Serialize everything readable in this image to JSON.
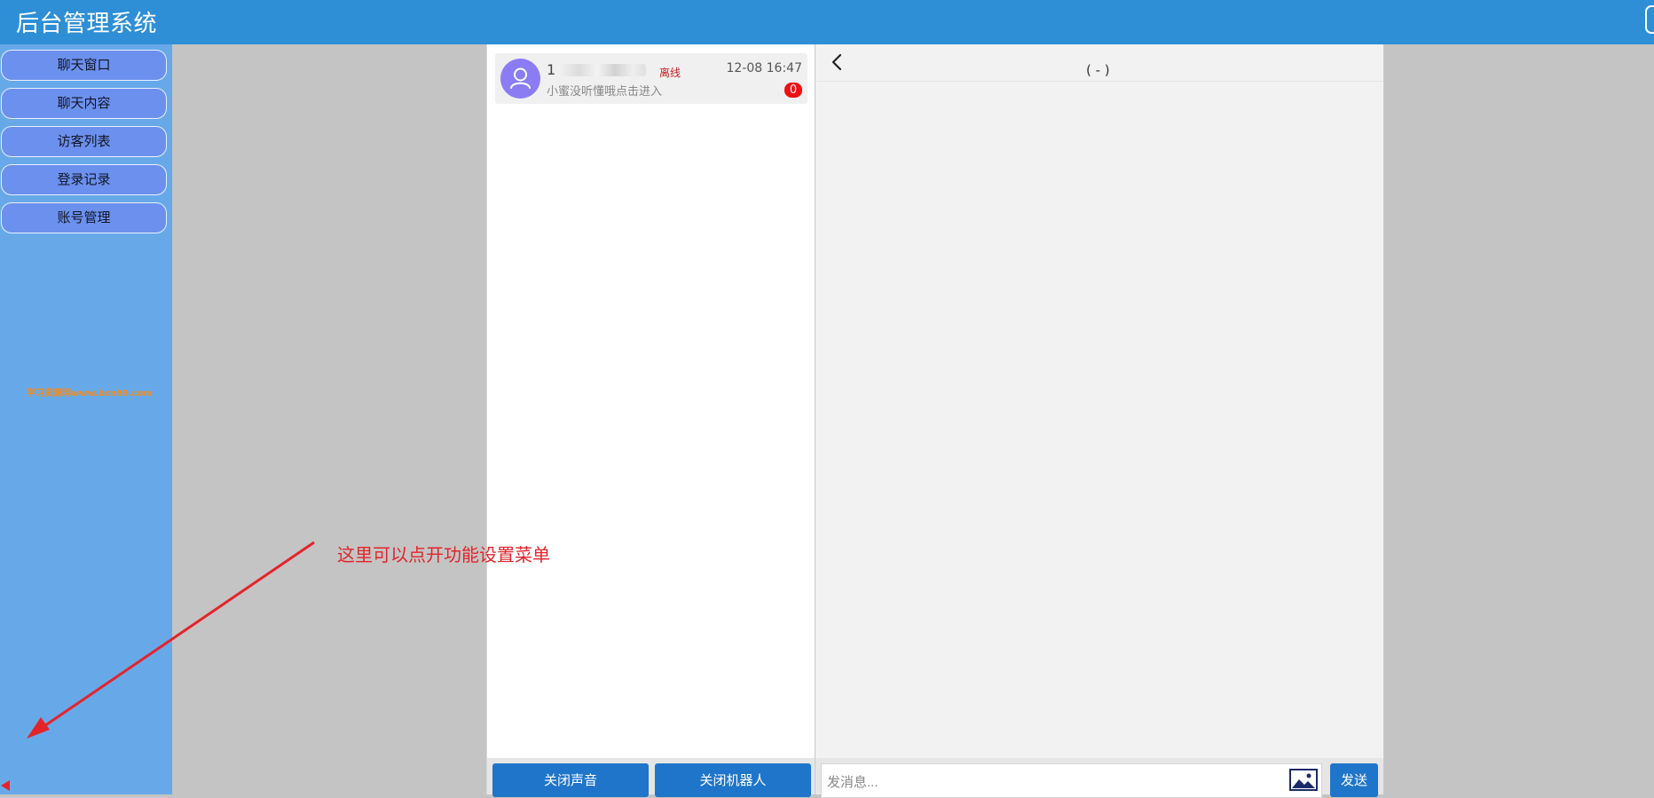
{
  "header": {
    "title": "后台管理系统"
  },
  "sidebar": {
    "items": [
      {
        "label": "聊天窗口"
      },
      {
        "label": "聊天内容"
      },
      {
        "label": "访客列表"
      },
      {
        "label": "登录记录"
      },
      {
        "label": "账号管理"
      }
    ],
    "watermark": "学习资源网www.bcn99.com"
  },
  "annotation": {
    "text": "这里可以点开功能设置菜单"
  },
  "conversations": [
    {
      "name": "1",
      "status": "离线",
      "time": "12-08 16:47",
      "preview": "小蜜没听懂哦点击进入",
      "unread": "0"
    }
  ],
  "conversation_actions": {
    "mute_label": "关闭声音",
    "robot_label": "关闭机器人"
  },
  "chat": {
    "title": "( - )",
    "input_placeholder": "发消息...",
    "send_label": "发送"
  },
  "colors": {
    "header_bg": "#2e8fd6",
    "sidebar_bg": "#67a9e8",
    "menu_button_bg": "#6c90ee",
    "primary_button": "#1f75c9",
    "annotation_red": "#e3242b",
    "badge_red": "#ee1111",
    "avatar_bg": "#8c7cf3"
  },
  "icons": {
    "avatar": "user-icon",
    "back": "chevron-left-icon",
    "image": "image-icon",
    "sidebar_toggle": "triangle-left-icon"
  }
}
